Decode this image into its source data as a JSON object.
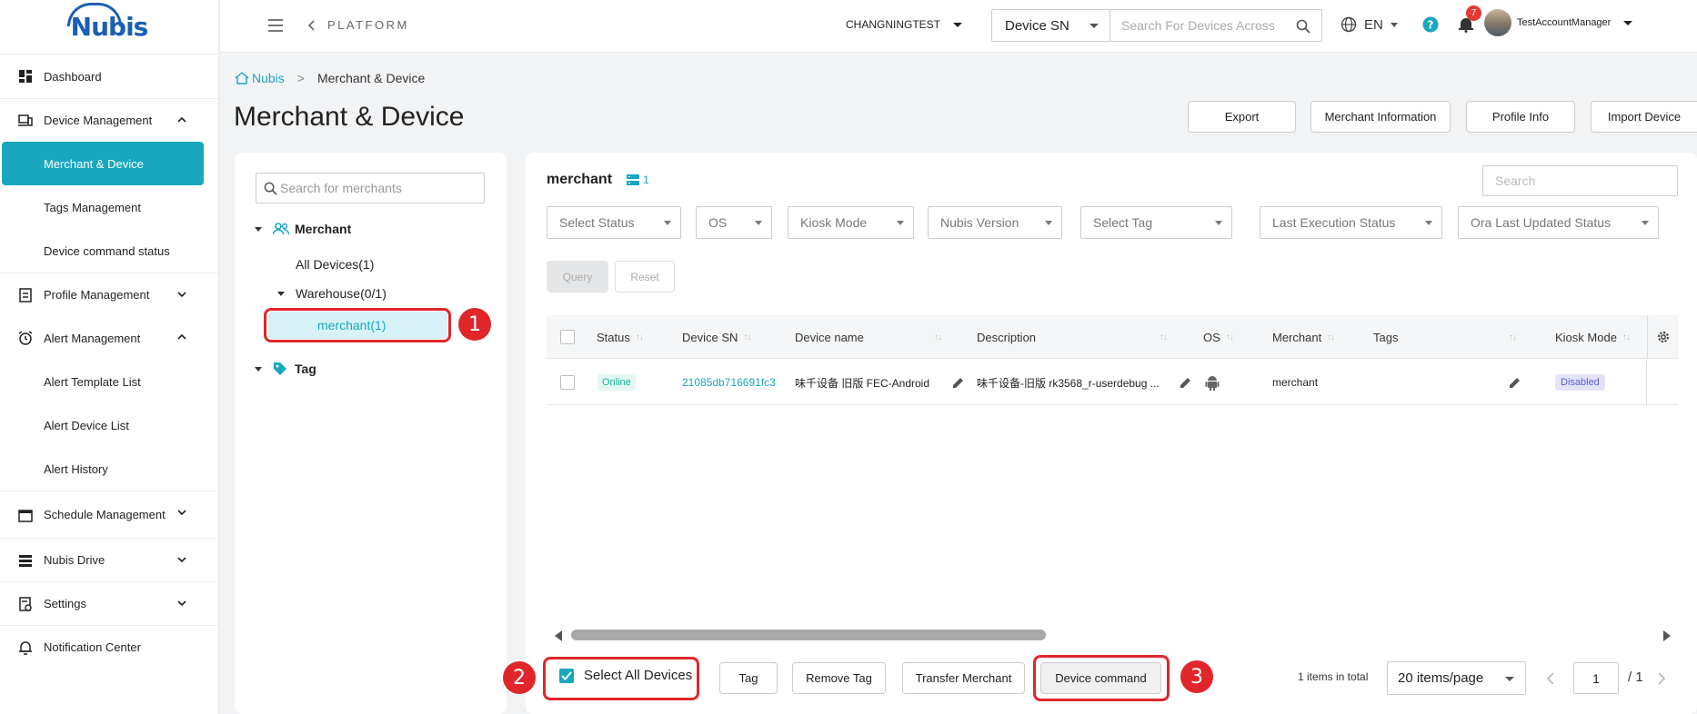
{
  "brand": {
    "logo_text": "Nubis"
  },
  "sidebar": {
    "items": [
      {
        "label": "Dashboard"
      },
      {
        "label": "Device Management"
      },
      {
        "label": "Merchant & Device"
      },
      {
        "label": "Tags Management"
      },
      {
        "label": "Device command status"
      },
      {
        "label": "Profile Management"
      },
      {
        "label": "Alert Management"
      },
      {
        "label": "Alert Template List"
      },
      {
        "label": "Alert Device List"
      },
      {
        "label": "Alert History"
      },
      {
        "label": "Schedule Management"
      },
      {
        "label": "Nubis Drive"
      },
      {
        "label": "Settings"
      },
      {
        "label": "Notification Center"
      }
    ]
  },
  "topbar": {
    "platform": "PLATFORM",
    "tenant": "CHANGNINGTEST",
    "search_type": "Device SN",
    "search_placeholder": "Search For Devices Across",
    "language": "EN",
    "notification_count": "7",
    "user": "TestAccountManager"
  },
  "breadcrumb": {
    "home": "Nubis",
    "current": "Merchant & Device"
  },
  "page": {
    "title": "Merchant & Device",
    "actions": {
      "export": "Export",
      "merchant_info": "Merchant Information",
      "profile_info": "Profile Info",
      "import_device": "Import Device"
    }
  },
  "tree": {
    "search_placeholder": "Search for merchants",
    "merchant_root": "Merchant",
    "all_devices": "All Devices(1)",
    "warehouse": "Warehouse(0/1)",
    "selected_merchant": "merchant(1)",
    "tag_root": "Tag"
  },
  "main": {
    "heading": "merchant",
    "count": "1",
    "search_placeholder": "Search",
    "filters": [
      "Select Status",
      "OS",
      "Kiosk Mode",
      "Nubis Version",
      "Select Tag",
      "Last Execution Status",
      "Ora Last Updated Status"
    ],
    "query": "Query",
    "reset": "Reset"
  },
  "table": {
    "columns": [
      "Status",
      "Device SN",
      "Device name",
      "Description",
      "OS",
      "Merchant",
      "Tags",
      "Kiosk Mode"
    ],
    "rows": [
      {
        "status": "Online",
        "sn": "21085db716691fc3",
        "name": "味千设备 旧版 FEC-Android",
        "description": "味千设备-旧版 rk3568_r-userdebug ...",
        "merchant": "merchant",
        "tags": "",
        "kiosk": "Disabled"
      }
    ]
  },
  "footer": {
    "select_all": "Select All Devices",
    "tag": "Tag",
    "remove_tag": "Remove Tag",
    "transfer": "Transfer Merchant",
    "device_command": "Device command",
    "total": "1 items in total",
    "page_size": "20 items/page",
    "page": "1",
    "pages": "/ 1"
  },
  "annotations": {
    "step1": "1",
    "step2": "2",
    "step3": "3"
  },
  "colors": {
    "accent": "#18a7bf",
    "annotation": "#e0262a",
    "online": "#19b39b"
  }
}
